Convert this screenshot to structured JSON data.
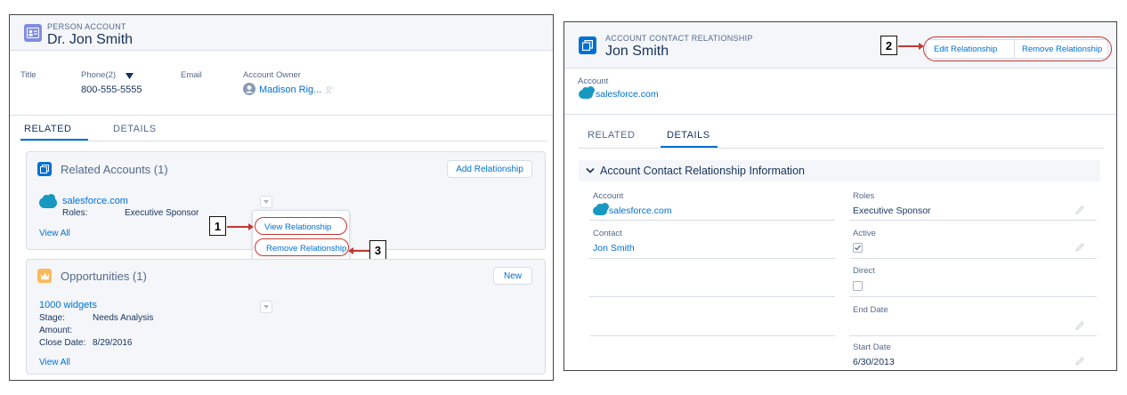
{
  "left": {
    "header": {
      "object_label": "PERSON ACCOUNT",
      "title": "Dr. Jon Smith"
    },
    "fields": {
      "title_label": "Title",
      "phone_label": "Phone(2)",
      "phone_value": "800-555-5555",
      "email_label": "Email",
      "owner_label": "Account Owner",
      "owner_value": "Madison Rig..."
    },
    "tabs": {
      "related": "RELATED",
      "details": "DETAILS"
    },
    "related_accounts": {
      "title": "Related Accounts (1)",
      "add_button": "Add Relationship",
      "account_name": "salesforce.com",
      "roles_label": "Roles:",
      "roles_value": "Executive Sponsor",
      "view_all": "View All",
      "menu": {
        "view": "View Relationship",
        "remove": "Remove Relationship"
      }
    },
    "opportunities": {
      "title": "Opportunities (1)",
      "new_button": "New",
      "name": "1000 widgets",
      "stage_label": "Stage:",
      "stage_value": "Needs Analysis",
      "amount_label": "Amount:",
      "close_label": "Close Date:",
      "close_value": "8/29/2016",
      "view_all": "View All"
    }
  },
  "right": {
    "header": {
      "object_label": "ACCOUNT CONTACT RELATIONSHIP",
      "title": "Jon Smith",
      "edit_button": "Edit Relationship",
      "remove_button": "Remove Relationship"
    },
    "account_label": "Account",
    "account_value": "salesforce.com",
    "tabs": {
      "related": "RELATED",
      "details": "DETAILS"
    },
    "section_title": "Account Contact Relationship Information",
    "fields": {
      "account_label": "Account",
      "account_value": "salesforce.com",
      "contact_label": "Contact",
      "contact_value": "Jon Smith",
      "roles_label": "Roles",
      "roles_value": "Executive Sponsor",
      "active_label": "Active",
      "active_checked": true,
      "direct_label": "Direct",
      "direct_checked": false,
      "end_date_label": "End Date",
      "start_date_label": "Start Date",
      "start_date_value": "6/30/2013"
    }
  },
  "callouts": {
    "one": "1",
    "two": "2",
    "three": "3"
  },
  "colors": {
    "accent": "#0070d2",
    "callout_red": "#c23934",
    "header_bg": "#f4f6f9",
    "cloud": "#1798c1"
  }
}
